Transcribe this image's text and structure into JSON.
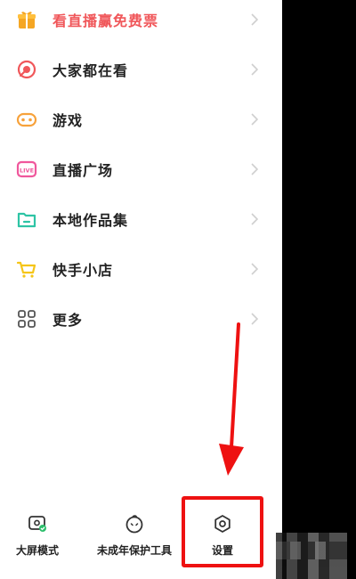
{
  "menu": {
    "items": [
      {
        "label": "看直播赢免费票",
        "icon": "gift-icon",
        "promo": true
      },
      {
        "label": "大家都在看",
        "icon": "popular-watch-icon"
      },
      {
        "label": "游戏",
        "icon": "gamepad-icon"
      },
      {
        "label": "直播广场",
        "icon": "live-tv-icon"
      },
      {
        "label": "本地作品集",
        "icon": "folder-icon"
      },
      {
        "label": "快手小店",
        "icon": "shopping-cart-icon"
      },
      {
        "label": "更多",
        "icon": "grid-more-icon"
      }
    ]
  },
  "bottom_bar": {
    "large_screen_label": "大屏模式",
    "minor_protection_label": "未成年保护工具",
    "settings_label": "设置"
  },
  "colors": {
    "promo": "#f0575a",
    "highlight": "#ee1111",
    "gift": "#f5a623",
    "popular": "#f0575a",
    "game": "#f7a23b",
    "live": "#f0579c",
    "folder": "#2ec4a5",
    "cart": "#f5c518"
  }
}
